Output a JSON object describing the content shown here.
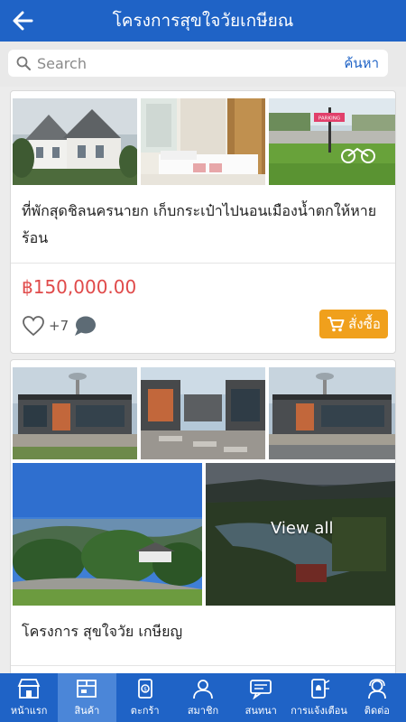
{
  "header": {
    "title": "โครงการสุขใจวัยเกษียณ"
  },
  "search": {
    "placeholder": "Search",
    "button_label": "ค้นหา"
  },
  "products": [
    {
      "title": "ที่พักสุดชิลนครนายก เก็บกระเป๋าไปนอนเมืองน้ำตกให้หายร้อน",
      "price": "฿150,000.00",
      "likes": "+7",
      "buy_label": "สั่งซื้อ",
      "sign_text": "PARKING"
    },
    {
      "title": "โครงการ สุขใจวัย เกษียญ",
      "view_all_label": "View all"
    }
  ],
  "bottom_nav": [
    {
      "label": "หน้าแรก",
      "icon": "shop-icon"
    },
    {
      "label": "สินค้า",
      "icon": "box-icon",
      "active": true
    },
    {
      "label": "ตะกร้า",
      "icon": "cart-icon"
    },
    {
      "label": "สมาชิก",
      "icon": "user-icon"
    },
    {
      "label": "สนทนา",
      "icon": "chat-icon"
    },
    {
      "label": "การแจ้งเตือน",
      "icon": "bell-icon"
    },
    {
      "label": "ติดต่อ",
      "icon": "contact-icon"
    }
  ],
  "colors": {
    "primary": "#1f63c6",
    "price": "#e04a4a",
    "buy": "#f0a01c"
  }
}
